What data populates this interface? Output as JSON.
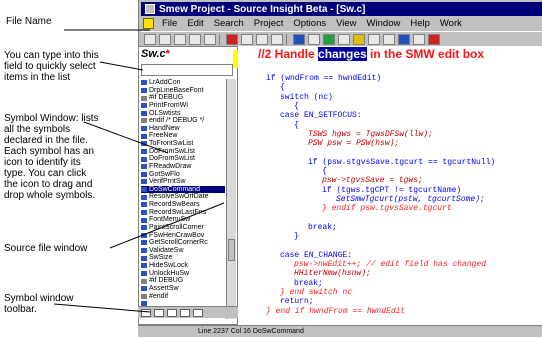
{
  "annotations": {
    "file_name": "File Name",
    "type_into": "You can type into this\nfield to quickly select\nitems in the list",
    "symbol_window": "Symbol Window: lists\nall the symbols\ndeclared in the file.\nEach symbol has an\nicon to identify its\ntype. You can click\nthe icon to drag and\ndrop whole symbols.",
    "source_window": "Source file window",
    "symbol_toolbar": "Symbol window\ntoolbar."
  },
  "window": {
    "title": "Smew Project - Source Insight Beta - [Sw.c]"
  },
  "menu": [
    "File",
    "Edit",
    "Search",
    "Project",
    "Options",
    "View",
    "Window",
    "Help",
    "Work"
  ],
  "symbol_panel": {
    "file_name": "Sw.c",
    "modified_mark": "*",
    "filter_value": "",
    "items": [
      {
        "label": "LrAddCon",
        "icon": "function-icon"
      },
      {
        "label": "DrpLineBaseFont",
        "icon": "function-icon"
      },
      {
        "label": "#if DEBUG",
        "icon": "ifdef-icon"
      },
      {
        "label": "PrintFromWi",
        "icon": "function-icon"
      },
      {
        "label": "OLSwtists",
        "icon": "function-icon"
      },
      {
        "label": "endif /* DEBUG */",
        "icon": "ifdef-icon"
      },
      {
        "label": "HandNew",
        "icon": "function-icon"
      },
      {
        "label": "FreeNew",
        "icon": "function-icon"
      },
      {
        "label": "ToFrontSwList",
        "icon": "function-icon"
      },
      {
        "label": "DoFromSwList",
        "icon": "function-icon"
      },
      {
        "label": "DoFromSwList",
        "icon": "function-icon"
      },
      {
        "label": "FReadwDraw",
        "icon": "function-icon"
      },
      {
        "label": "GotSwFlo",
        "icon": "function-icon"
      },
      {
        "label": "VerifPrntSw",
        "icon": "function-icon"
      },
      {
        "label": "DoSwCommand",
        "icon": "function-icon"
      },
      {
        "label": "ResolveSwOrfDate",
        "icon": "function-icon"
      },
      {
        "label": "RecordSwBears",
        "icon": "function-icon"
      },
      {
        "label": "RecordSwLastFns",
        "icon": "function-icon"
      },
      {
        "label": "FontMenuSw",
        "icon": "function-icon"
      },
      {
        "label": "PaintScrollCorner",
        "icon": "function-icon"
      },
      {
        "label": "FSwHenCrawBov",
        "icon": "function-icon"
      },
      {
        "label": "GetScrollCornerRc",
        "icon": "function-icon"
      },
      {
        "label": "ValidateSw",
        "icon": "function-icon"
      },
      {
        "label": "SwSize",
        "icon": "function-icon"
      },
      {
        "label": "HideSwLock",
        "icon": "function-icon"
      },
      {
        "label": "UnlockHuSw",
        "icon": "function-icon"
      },
      {
        "label": "#if DEBUG",
        "icon": "ifdef-icon"
      },
      {
        "label": "AssertSw",
        "icon": "function-icon"
      },
      {
        "label": "#endif",
        "icon": "ifdef-icon"
      },
      {
        "label": "",
        "icon": "function-icon"
      },
      {
        "label": "",
        "icon": "function-icon"
      }
    ],
    "selected_index": 14
  },
  "editor": {
    "comment_prefix": "//2 Handle ",
    "comment_highlight": "changes",
    "comment_suffix": " in the SMW edit box",
    "lines": [
      {
        "text": "if (wndFrom == hwndEdit)",
        "indent": 0,
        "style": "kw"
      },
      {
        "text": "{",
        "indent": 1,
        "style": "kw"
      },
      {
        "text": "switch (nc)",
        "indent": 1,
        "style": "kw"
      },
      {
        "text": "{",
        "indent": 2,
        "style": "kw"
      },
      {
        "text": "case EN_SETFOCUS:",
        "indent": 1,
        "style": "kw"
      },
      {
        "text": "{",
        "indent": 2,
        "style": "kw"
      },
      {
        "text": "TSWS hgws = TgwsDFSw(llw);",
        "indent": 3,
        "style": "sym"
      },
      {
        "text": "PSW psw = PSW(hsw);",
        "indent": 3,
        "style": "sym"
      },
      {
        "text": "",
        "indent": 0,
        "style": "kw"
      },
      {
        "text": "if (psw.stgvsSave.tgcurt == tgcurtNull)",
        "indent": 3,
        "style": "kw"
      },
      {
        "text": "{",
        "indent": 4,
        "style": "kw"
      },
      {
        "text": "psw->tgvsSave = tgws;",
        "indent": 4,
        "style": "sym"
      },
      {
        "text": "if (tgws.tgCPT != tgcurtName)",
        "indent": 4,
        "style": "kw"
      },
      {
        "text": "SetSmwTgcurt(pstw, tgcurtSome);",
        "indent": 5,
        "style": "sym2"
      },
      {
        "text": "} endif psw.tgvsSave.tgcurt",
        "indent": 4,
        "style": "cmt"
      },
      {
        "text": "",
        "indent": 0,
        "style": "kw"
      },
      {
        "text": "break;",
        "indent": 3,
        "style": "kw"
      },
      {
        "text": "}",
        "indent": 2,
        "style": "kw"
      },
      {
        "text": "",
        "indent": 0,
        "style": "kw"
      },
      {
        "text": "case EN_CHANGE:",
        "indent": 1,
        "style": "kw"
      },
      {
        "text": "psw->nwEdit++; // edit field has changed",
        "indent": 2,
        "style": "cmt"
      },
      {
        "text": "HHiterNmw(hsnw);",
        "indent": 2,
        "style": "sym"
      },
      {
        "text": "break;",
        "indent": 2,
        "style": "kw"
      },
      {
        "text": "} end switch nc",
        "indent": 1,
        "style": "cmt"
      },
      {
        "text": "return;",
        "indent": 1,
        "style": "kw"
      },
      {
        "text": "} end if hwndFrom == hwndEdit",
        "indent": 0,
        "style": "cmt"
      }
    ]
  },
  "status": {
    "text": "Line 2237  Col 16  DoSwCommand"
  }
}
